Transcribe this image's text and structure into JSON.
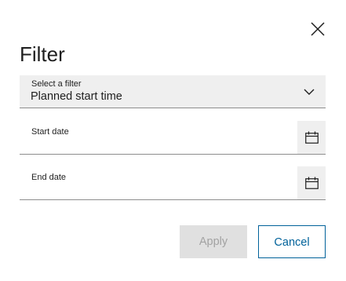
{
  "dialog": {
    "title": "Filter",
    "close_icon": "close-icon"
  },
  "filter_select": {
    "label": "Select a filter",
    "value": "Planned start time",
    "icon": "chevron-down-icon"
  },
  "start_date": {
    "label": "Start date",
    "value": "",
    "icon": "calendar-icon"
  },
  "end_date": {
    "label": "End date",
    "value": "",
    "icon": "calendar-icon"
  },
  "buttons": {
    "apply_label": "Apply",
    "apply_enabled": false,
    "cancel_label": "Cancel"
  },
  "colors": {
    "accent": "#00629a",
    "field_background": "#efefef",
    "disabled_background": "#e0e0e0",
    "disabled_text": "#a2a2a2"
  }
}
